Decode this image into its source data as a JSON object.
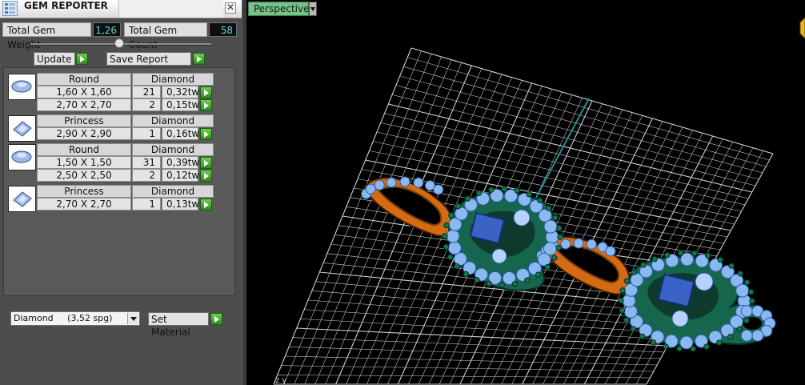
{
  "panel": {
    "title": "GEM REPORTER",
    "close_glyph": "✕",
    "total_weight_label": "Total Gem Weight",
    "total_weight_value": "1,26",
    "total_count_label": "Total Gem Count",
    "total_count_value": "58",
    "update_label": "Update",
    "save_report_label": "Save Report",
    "gem_groups": [
      {
        "icon": "round-gem-icon",
        "shape": "Round",
        "material": "Diamond",
        "rows": [
          {
            "size": "1,60 X 1,60",
            "count": "21",
            "weight": "0,32tw"
          },
          {
            "size": "2,70 X 2,70",
            "count": "2",
            "weight": "0,15tw"
          }
        ]
      },
      {
        "icon": "princess-gem-icon",
        "shape": "Princess",
        "material": "Diamond",
        "rows": [
          {
            "size": "2,90 X 2,90",
            "count": "1",
            "weight": "0,16tw"
          }
        ]
      },
      {
        "icon": "round-gem-icon",
        "shape": "Round",
        "material": "Diamond",
        "rows": [
          {
            "size": "1,50 X 1,50",
            "count": "31",
            "weight": "0,39tw"
          },
          {
            "size": "2,50 X 2,50",
            "count": "2",
            "weight": "0,12tw"
          }
        ]
      },
      {
        "icon": "princess-gem-icon",
        "shape": "Princess",
        "material": "Diamond",
        "rows": [
          {
            "size": "2,70 X 2,70",
            "count": "1",
            "weight": "0,13tw"
          }
        ]
      }
    ],
    "material_select": {
      "name": "Diamond",
      "density": "(3,52 spg)"
    },
    "set_material_label": "Set Material"
  },
  "viewport": {
    "view_name": "Perspective",
    "axis_label": "z y"
  },
  "colors": {
    "grid": "#d0d0d0",
    "axis_teal": "#1f8f96",
    "metal_orange": "#d46a12",
    "enamel_green": "#16664d",
    "gem_blue": "#8ab8f0"
  }
}
